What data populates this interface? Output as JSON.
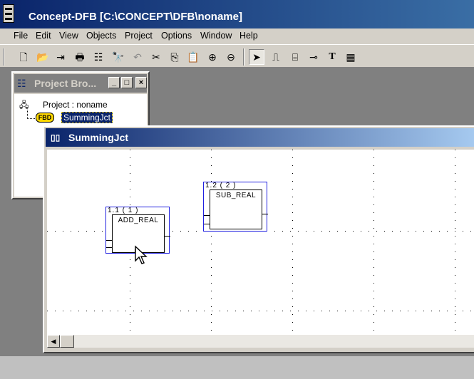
{
  "app": {
    "title": "Concept-DFB [C:\\CONCEPT\\DFB\\noname]"
  },
  "menu": [
    "File",
    "Edit",
    "View",
    "Objects",
    "Project",
    "Options",
    "Window",
    "Help"
  ],
  "toolbar": {
    "buttons": [
      "new-icon",
      "open-icon",
      "save-icon",
      "print-icon",
      "tree-icon",
      "find-icon",
      "undo-icon",
      "cut-icon",
      "copy-icon",
      "paste-icon",
      "zoom-in-icon",
      "zoom-out-icon",
      "select-icon",
      "link-icon",
      "ffb-icon",
      "connect-icon",
      "text-icon",
      "grid-icon"
    ],
    "glyphs": [
      "🗋",
      "📂",
      "⇥",
      "🖶",
      "☷",
      "🔭",
      "↶",
      "✂",
      "⎘",
      "📋",
      "⊕",
      "⊖",
      "➤",
      "⎍",
      "⌸",
      "⊸",
      "T",
      "▦"
    ]
  },
  "project_browser": {
    "title": "Project Bro...",
    "project_label": "Project : noname",
    "badge": "FBD",
    "dfb_name": "SummingJct"
  },
  "editor": {
    "title": "SummingJct",
    "blocks": [
      {
        "id": "1.1 ( 1 )",
        "name": "ADD_REAL"
      },
      {
        "id": "1.2 ( 2 )",
        "name": "SUB_REAL"
      }
    ]
  },
  "colors": {
    "title_active": "#0a246a",
    "title_inactive": "#808080",
    "selection": "#2020e0",
    "badge": "#ffd800"
  }
}
